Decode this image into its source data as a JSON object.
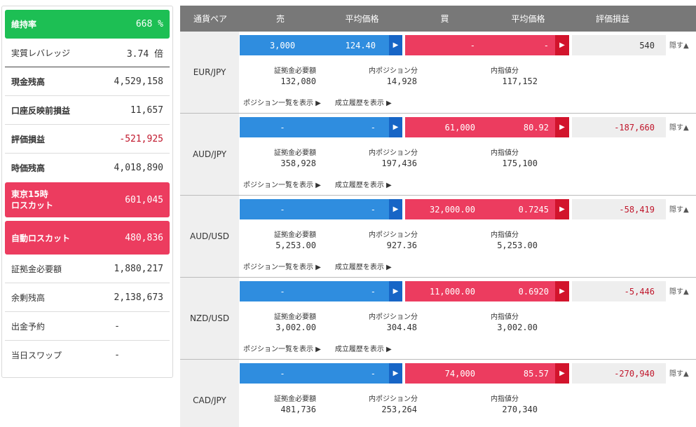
{
  "summary": {
    "margin_ratio_label": "維持率",
    "margin_ratio_value": "668 %",
    "leverage_label": "実質レバレッジ",
    "leverage_value": "3.74 倍",
    "cash_label": "現金残高",
    "cash_value": "4,529,158",
    "unreflected_label": "口座反映前損益",
    "unreflected_value": "11,657",
    "unrealized_label": "評価損益",
    "unrealized_value": "-521,925",
    "equity_label": "時価残高",
    "equity_value": "4,018,890",
    "tokyo_losscut_label_line1": "東京15時",
    "tokyo_losscut_label_line2": "ロスカット",
    "tokyo_losscut_value": "601,045",
    "auto_losscut_label": "自動ロスカット",
    "auto_losscut_value": "480,836",
    "required_margin_label": "証拠金必要額",
    "required_margin_value": "1,880,217",
    "surplus_label": "余剰残高",
    "surplus_value": "2,138,673",
    "withdraw_label": "出金予約",
    "withdraw_value": "-",
    "swap_label": "当日スワップ",
    "swap_value": "-"
  },
  "header": {
    "pair": "通貨ペア",
    "sell": "売",
    "sell_avg": "平均価格",
    "buy": "買",
    "buy_avg": "平均価格",
    "pl": "評価損益"
  },
  "labels": {
    "required_margin": "証拠金必要額",
    "in_position": "内ポジション分",
    "in_limit": "内指値分",
    "show_positions": "ポジション一覧を表示 ▶",
    "show_history": "成立履歴を表示 ▶",
    "hide": "隠す▲",
    "arrow": "▶"
  },
  "colors": {
    "green": "#1dbf54",
    "sell_blue": "#2f8ddf",
    "buy_red": "#ec3c5f",
    "negative_text": "#c0162b"
  },
  "positions": [
    {
      "pair": "EUR/JPY",
      "sell_qty": "3,000",
      "sell_avg": "124.40",
      "buy_qty": "-",
      "buy_avg": "-",
      "pl": "540",
      "pl_negative": false,
      "required_margin": "132,080",
      "in_position": "14,928",
      "in_limit": "117,152"
    },
    {
      "pair": "AUD/JPY",
      "sell_qty": "-",
      "sell_avg": "-",
      "buy_qty": "61,000",
      "buy_avg": "80.92",
      "pl": "-187,660",
      "pl_negative": true,
      "required_margin": "358,928",
      "in_position": "197,436",
      "in_limit": "175,100"
    },
    {
      "pair": "AUD/USD",
      "sell_qty": "-",
      "sell_avg": "-",
      "buy_qty": "32,000.00",
      "buy_avg": "0.7245",
      "pl": "-58,419",
      "pl_negative": true,
      "required_margin": "5,253.00",
      "in_position": "927.36",
      "in_limit": "5,253.00"
    },
    {
      "pair": "NZD/USD",
      "sell_qty": "-",
      "sell_avg": "-",
      "buy_qty": "11,000.00",
      "buy_avg": "0.6920",
      "pl": "-5,446",
      "pl_negative": true,
      "required_margin": "3,002.00",
      "in_position": "304.48",
      "in_limit": "3,002.00"
    },
    {
      "pair": "CAD/JPY",
      "sell_qty": "-",
      "sell_avg": "-",
      "buy_qty": "74,000",
      "buy_avg": "85.57",
      "pl": "-270,940",
      "pl_negative": true,
      "required_margin": "481,736",
      "in_position": "253,264",
      "in_limit": "270,340"
    }
  ]
}
